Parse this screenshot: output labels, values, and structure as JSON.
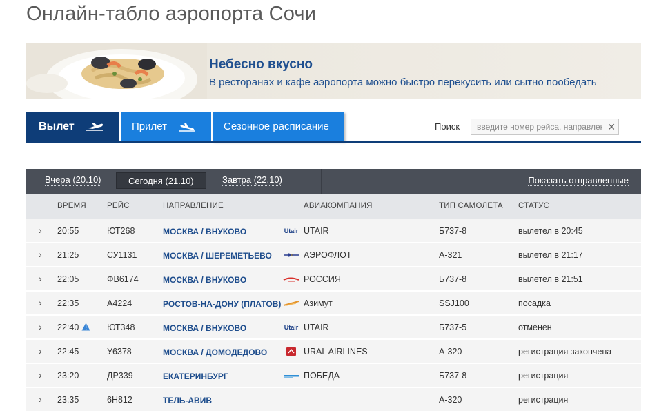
{
  "page": {
    "title": "Онлайн-табло аэропорта Сочи"
  },
  "banner": {
    "title": "Небесно вкусно",
    "text": "В ресторанах и кафе аэропорта можно быстро перекусить или сытно пообедать"
  },
  "tabs": {
    "departure": "Вылет",
    "arrival": "Прилет",
    "seasonal": "Сезонное расписание"
  },
  "search": {
    "label": "Поиск",
    "placeholder": "введите номер рейса, направление",
    "clear": "✕"
  },
  "days": {
    "yesterday": "Вчера (20.10)",
    "today": "Сегодня (21.10)",
    "tomorrow": "Завтра (22.10)",
    "show_departed": "Показать отправленные"
  },
  "columns": {
    "time": "ВРЕМЯ",
    "flight": "РЕЙС",
    "destination": "НАПРАВЛЕНИЕ",
    "airline": "АВИАКОМПАНИЯ",
    "plane": "ТИП САМОЛЕТА",
    "status": "СТАТУС"
  },
  "colors": {
    "departure_tab": "#0e3d78",
    "tab_blue": "#1a7fde",
    "day_bar": "#4a4f58",
    "destination_text": "#1d4c8c"
  },
  "flights": [
    {
      "time": "20:55",
      "flight": "ЮТ268",
      "destination": "МОСКВА / ВНУКОВО",
      "logo": "utair-logo-icon",
      "logo_text": "Utair",
      "airline": "UTAIR",
      "plane": "Б737-8",
      "status": "вылетел в 20:45",
      "warning": false
    },
    {
      "time": "21:25",
      "flight": "СУ1131",
      "destination": "МОСКВА / ШЕРЕМЕТЬЕВО",
      "logo": "aeroflot-logo-icon",
      "logo_text": "",
      "airline": "АЭРОФЛОТ",
      "plane": "А-321",
      "status": "вылетел в 21:17",
      "warning": false
    },
    {
      "time": "22:05",
      "flight": "ФВ6174",
      "destination": "МОСКВА / ВНУКОВО",
      "logo": "rossiya-logo-icon",
      "logo_text": "",
      "airline": "РОССИЯ",
      "plane": "Б737-8",
      "status": "вылетел в 21:51",
      "warning": false
    },
    {
      "time": "22:35",
      "flight": "А4224",
      "destination": "РОСТОВ-НА-ДОНУ (ПЛАТОВ)",
      "logo": "azimut-logo-icon",
      "logo_text": "",
      "airline": "Азимут",
      "plane": "SSJ100",
      "status": "посадка",
      "warning": false
    },
    {
      "time": "22:40",
      "flight": "ЮТ348",
      "destination": "МОСКВА / ВНУКОВО",
      "logo": "utair-logo-icon",
      "logo_text": "Utair",
      "airline": "UTAIR",
      "plane": "Б737-5",
      "status": "отменен",
      "warning": true
    },
    {
      "time": "22:45",
      "flight": "У6378",
      "destination": "МОСКВА / ДОМОДЕДОВО",
      "logo": "ural-airlines-logo-icon",
      "logo_text": "",
      "airline": "URAL AIRLINES",
      "plane": "А-320",
      "status": "регистрация закончена",
      "warning": false
    },
    {
      "time": "23:20",
      "flight": "ДР339",
      "destination": "ЕКАТЕРИНБУРГ",
      "logo": "pobeda-logo-icon",
      "logo_text": "",
      "airline": "ПОБЕДА",
      "plane": "Б737-8",
      "status": "регистрация",
      "warning": false
    },
    {
      "time": "23:35",
      "flight": "6Н812",
      "destination": "ТЕЛЬ-АВИВ",
      "logo": "",
      "logo_text": "",
      "airline": "",
      "plane": "А-320",
      "status": "регистрация",
      "warning": false
    }
  ]
}
